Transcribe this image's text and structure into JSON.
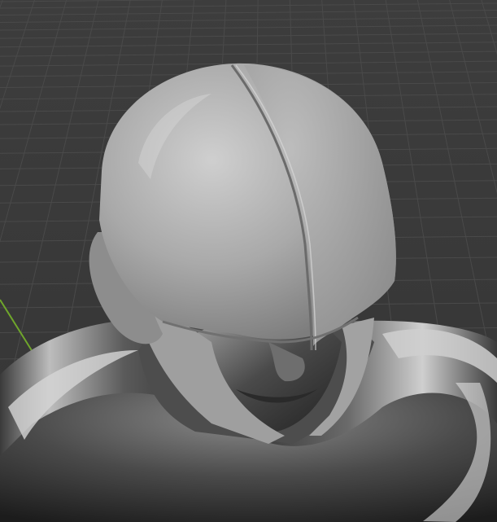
{
  "app": {
    "type": "3d-viewport",
    "scene": {
      "model": "sculpted-helmeted-head-with-collar",
      "grid": true,
      "grid_plane": "ground",
      "visible_axis": "y-axis-green"
    },
    "colors": {
      "background": "#393939",
      "grid_line": "#4a4a4a",
      "grid_major": "#525252",
      "y_axis": "#6fa62b",
      "helmet_base": "#9a9a9a",
      "helmet_light": "#c9c9c9",
      "metal_dark": "#2c2c2c",
      "metal_light": "#d8d8d8"
    }
  }
}
